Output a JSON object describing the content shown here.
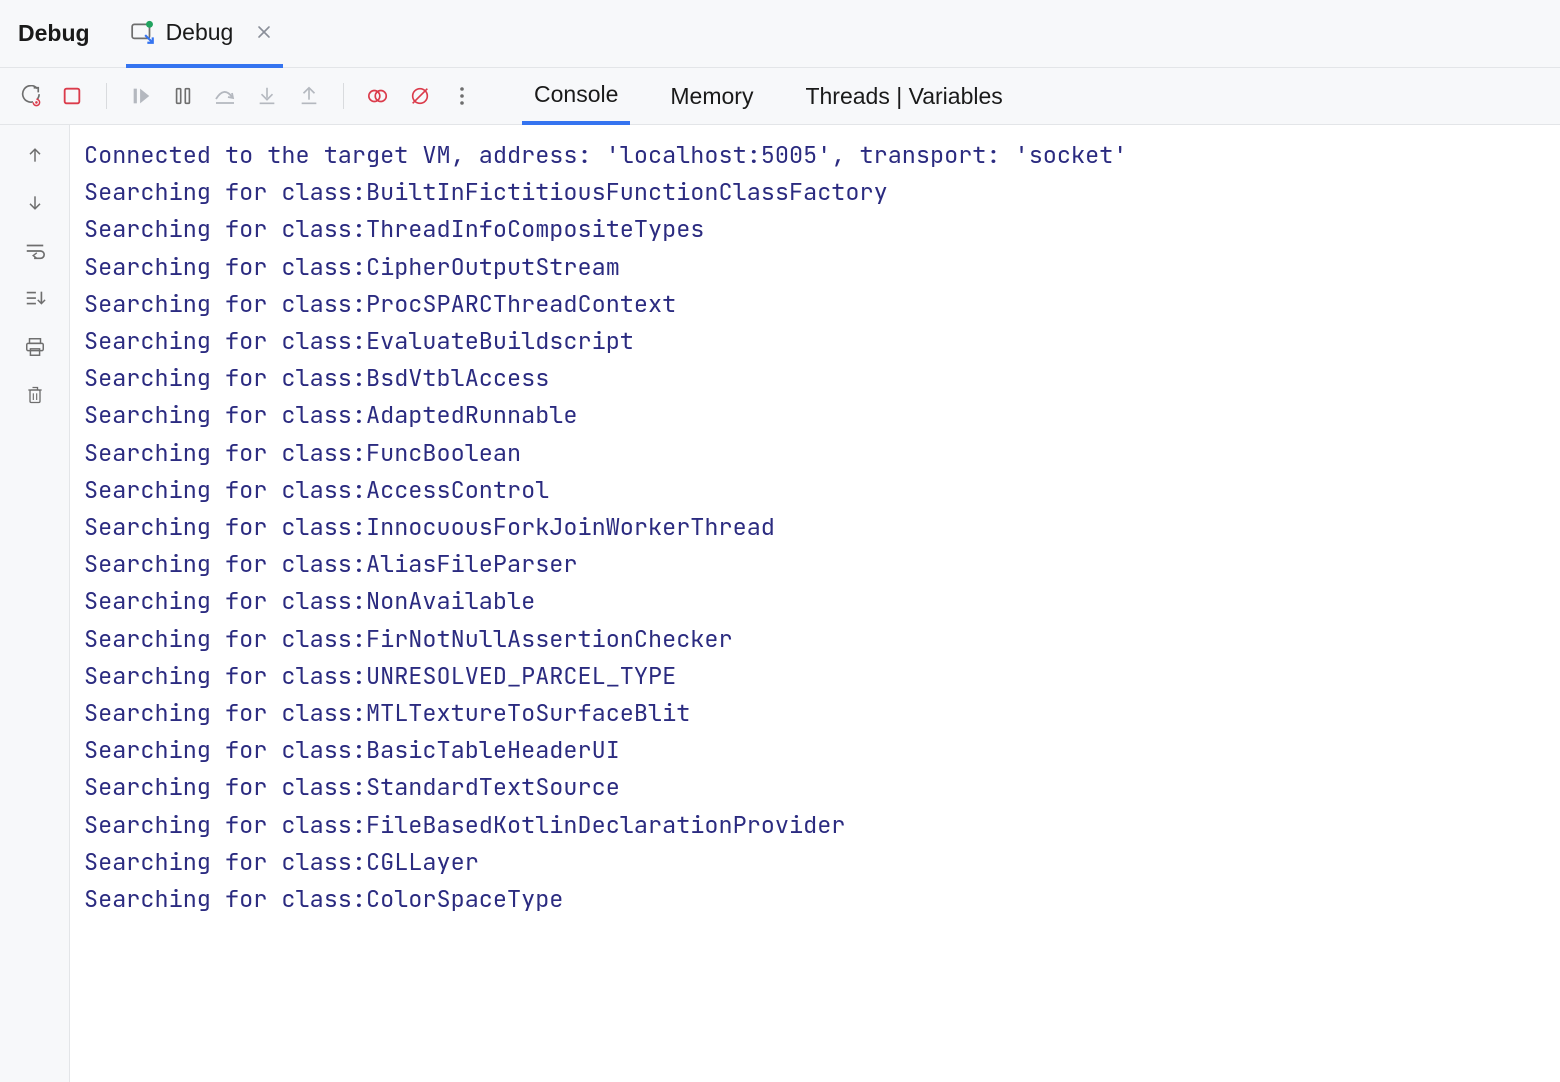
{
  "header": {
    "panel_title": "Debug",
    "run_tab_label": "Debug"
  },
  "tabs": {
    "console": "Console",
    "memory": "Memory",
    "threads_vars": "Threads | Variables"
  },
  "console_lines": [
    "Connected to the target VM, address: 'localhost:5005', transport: 'socket'",
    "Searching for class:BuiltInFictitiousFunctionClassFactory",
    "Searching for class:ThreadInfoCompositeTypes",
    "Searching for class:CipherOutputStream",
    "Searching for class:ProcSPARCThreadContext",
    "Searching for class:EvaluateBuildscript",
    "Searching for class:BsdVtblAccess",
    "Searching for class:AdaptedRunnable",
    "Searching for class:FuncBoolean",
    "Searching for class:AccessControl",
    "Searching for class:InnocuousForkJoinWorkerThread",
    "Searching for class:AliasFileParser",
    "Searching for class:NonAvailable",
    "Searching for class:FirNotNullAssertionChecker",
    "Searching for class:UNRESOLVED_PARCEL_TYPE",
    "Searching for class:MTLTextureToSurfaceBlit",
    "Searching for class:BasicTableHeaderUI",
    "Searching for class:StandardTextSource",
    "Searching for class:FileBasedKotlinDeclarationProvider",
    "Searching for class:CGLLayer",
    "Searching for class:ColorSpaceType"
  ]
}
